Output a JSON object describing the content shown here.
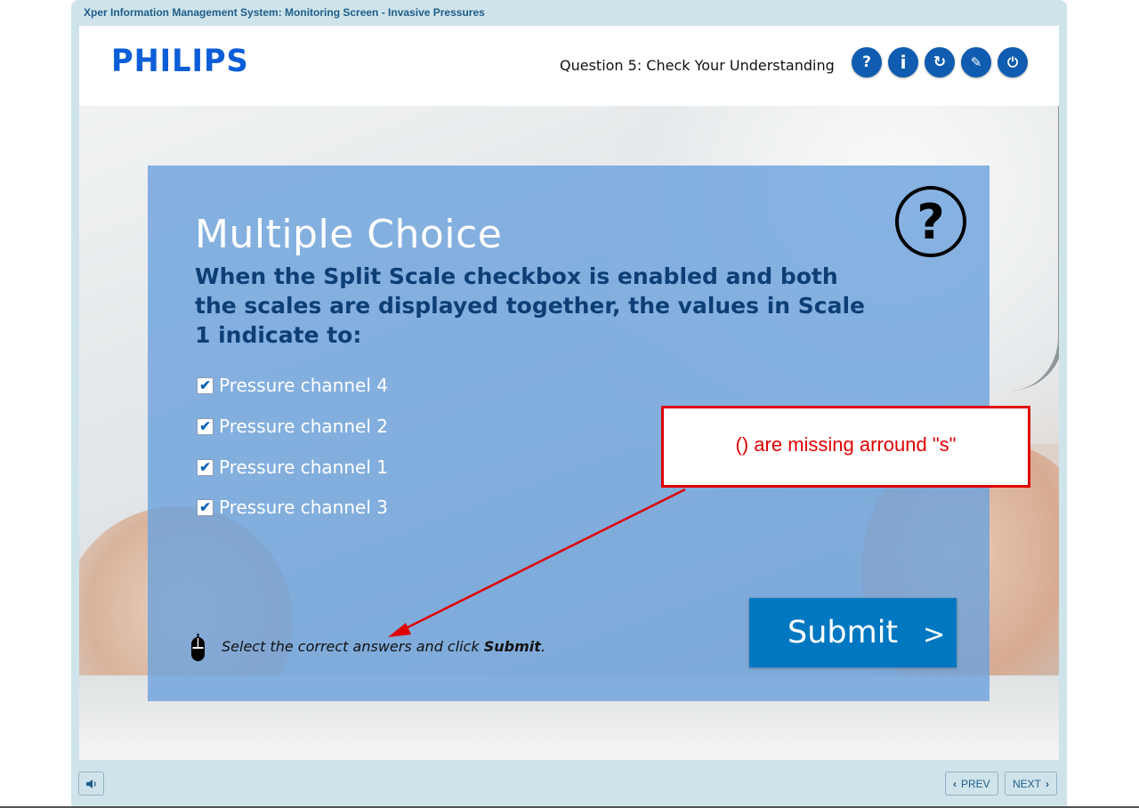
{
  "window": {
    "title": "Xper Information Management System: Monitoring Screen - Invasive Pressures"
  },
  "header": {
    "logo": "PHILIPS",
    "question_title": "Question 5: Check Your Understanding",
    "buttons": [
      {
        "glyph": "?",
        "icon": "help-icon"
      },
      {
        "glyph": "i",
        "icon": "info-icon"
      },
      {
        "glyph": "↻",
        "icon": "replay-icon"
      },
      {
        "glyph": "✎",
        "icon": "navigate-icon"
      },
      {
        "glyph": "⏻",
        "icon": "power-icon"
      }
    ]
  },
  "quiz": {
    "type_label": "Multiple Choice",
    "question": "When the Split Scale checkbox is enabled and both the scales are displayed together, the values in Scale 1 indicate to:",
    "options": [
      {
        "label": "Pressure channel 4",
        "checked": true
      },
      {
        "label": "Pressure channel 2",
        "checked": true
      },
      {
        "label": "Pressure channel 1",
        "checked": true
      },
      {
        "label": "Pressure channel 3",
        "checked": true
      }
    ],
    "instruction_prefix": "Select the correct answers and click ",
    "instruction_bold": "Submit",
    "instruction_suffix": ".",
    "submit_label": "Submit",
    "submit_chevron": ">"
  },
  "annotation": {
    "text": "() are missing arround \"s\"",
    "color": "#e00000"
  },
  "footer": {
    "prev_label": "PREV",
    "next_label": "NEXT"
  },
  "colors": {
    "accent_blue": "#0078c1",
    "header_button": "#0f5cb0",
    "logo_blue": "#0b5ed7",
    "question_text": "#0d3f76"
  }
}
